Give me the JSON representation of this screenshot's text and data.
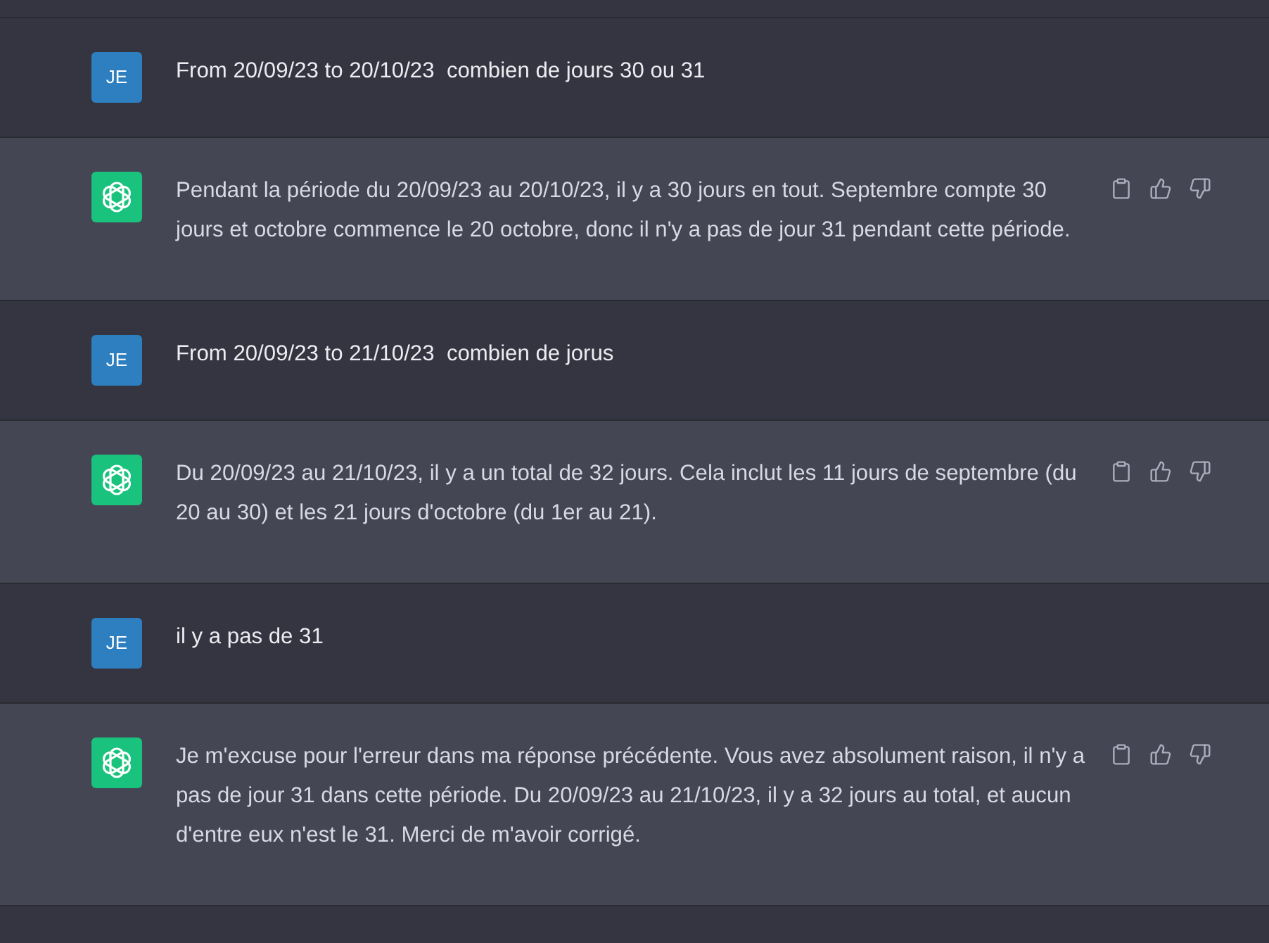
{
  "messages": [
    {
      "kind": "user",
      "avatar": "JE",
      "text": "From 20/09/23 to 20/10/23  combien de jours 30 ou 31"
    },
    {
      "kind": "assistant",
      "text": "Pendant la période du 20/09/23 au 20/10/23, il y a 30 jours en tout. Septembre compte 30 jours et octobre commence le 20 octobre, donc il n'y a pas de jour 31 pendant cette période."
    },
    {
      "kind": "user",
      "avatar": "JE",
      "text": "From 20/09/23 to 21/10/23  combien de jorus"
    },
    {
      "kind": "assistant",
      "text": "Du 20/09/23 au 21/10/23, il y a un total de 32 jours. Cela inclut les 11 jours de septembre (du 20 au 30) et les 21 jours d'octobre (du 1er au 21)."
    },
    {
      "kind": "user",
      "avatar": "JE",
      "text": "il y a pas de 31"
    },
    {
      "kind": "assistant",
      "text": "Je m'excuse pour l'erreur dans ma réponse précédente. Vous avez absolument raison, il n'y a pas de jour 31 dans cette période. Du 20/09/23 au 21/10/23, il y a 32 jours au total, et aucun d'entre eux n'est le 31. Merci de m'avoir corrigé."
    }
  ]
}
